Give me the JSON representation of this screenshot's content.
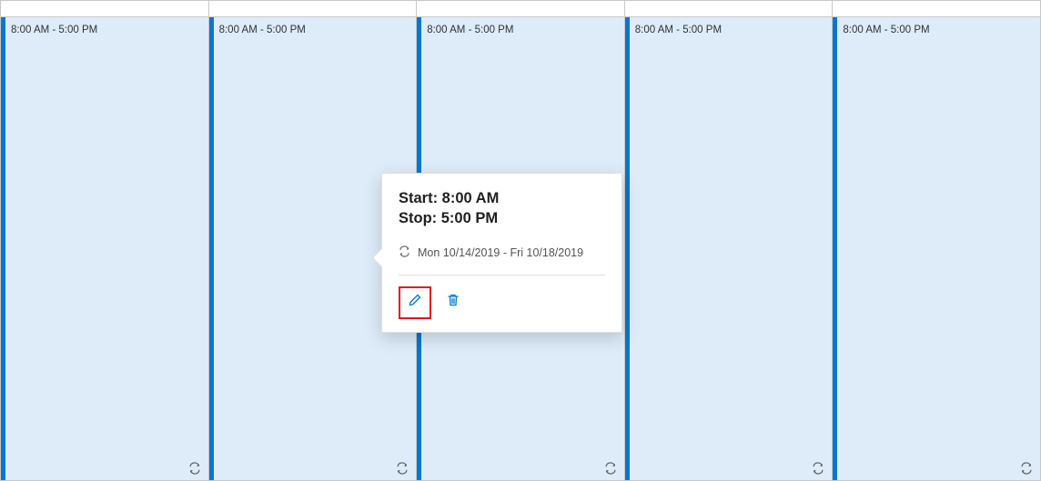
{
  "columns": [
    {
      "time_label": "8:00 AM - 5:00 PM"
    },
    {
      "time_label": "8:00 AM - 5:00 PM"
    },
    {
      "time_label": "8:00 AM - 5:00 PM"
    },
    {
      "time_label": "8:00 AM - 5:00 PM"
    },
    {
      "time_label": "8:00 AM - 5:00 PM"
    }
  ],
  "popover": {
    "start_line": "Start: 8:00 AM",
    "stop_line": "Stop: 5:00 PM",
    "recurrence_range": "Mon 10/14/2019 - Fri 10/18/2019"
  },
  "colors": {
    "accent": "#0078d4",
    "event_bg": "#deecf9",
    "highlight": "#e81123"
  }
}
